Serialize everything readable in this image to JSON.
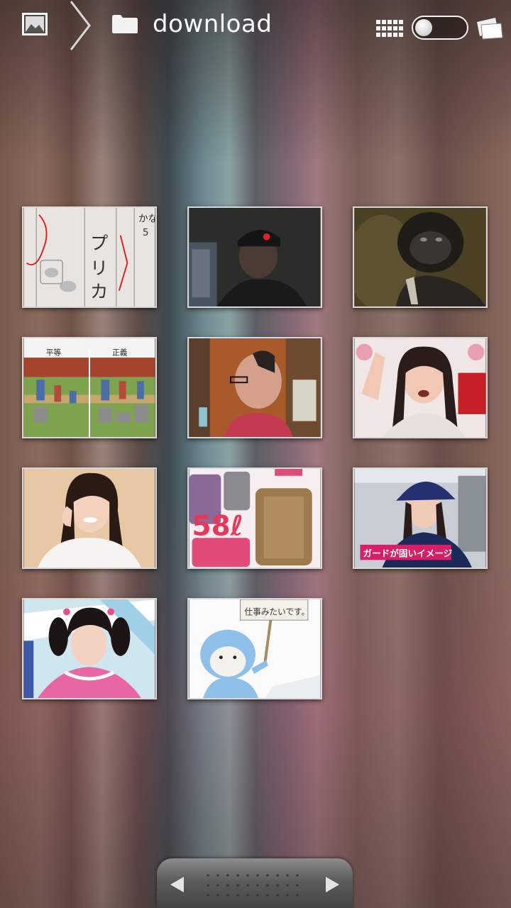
{
  "header": {
    "title": "download",
    "icons": [
      "gallery-icon",
      "chevron-right-icon",
      "folder-icon",
      "grid-view-icon",
      "view-toggle",
      "stack-view-icon"
    ]
  },
  "thumbnails": [
    {
      "name": "thumb-handwriting-test",
      "caption": "",
      "text": "カ"
    },
    {
      "name": "thumb-man-in-cap",
      "caption": ""
    },
    {
      "name": "thumb-gorilla",
      "caption": ""
    },
    {
      "name": "thumb-fence-cartoon",
      "caption": "",
      "labels": [
        "平等",
        "正義"
      ]
    },
    {
      "name": "thumb-man-glasses",
      "caption": ""
    },
    {
      "name": "thumb-girl-shouting",
      "caption": ""
    },
    {
      "name": "thumb-girl-smiling",
      "caption": ""
    },
    {
      "name": "thumb-suitcases",
      "caption": "",
      "text": "58ℓ"
    },
    {
      "name": "thumb-girl-uniform",
      "caption": "",
      "text": "ガードが固いイメージ"
    },
    {
      "name": "thumb-girl-pigtails",
      "caption": ""
    },
    {
      "name": "thumb-monkey-sign",
      "caption": "",
      "text": "仕事みたいです。"
    }
  ],
  "pager": {
    "left": "◀",
    "right": "▶"
  },
  "colors": {
    "title": "#ffffff",
    "thumb_border": "#d8d8d8"
  }
}
